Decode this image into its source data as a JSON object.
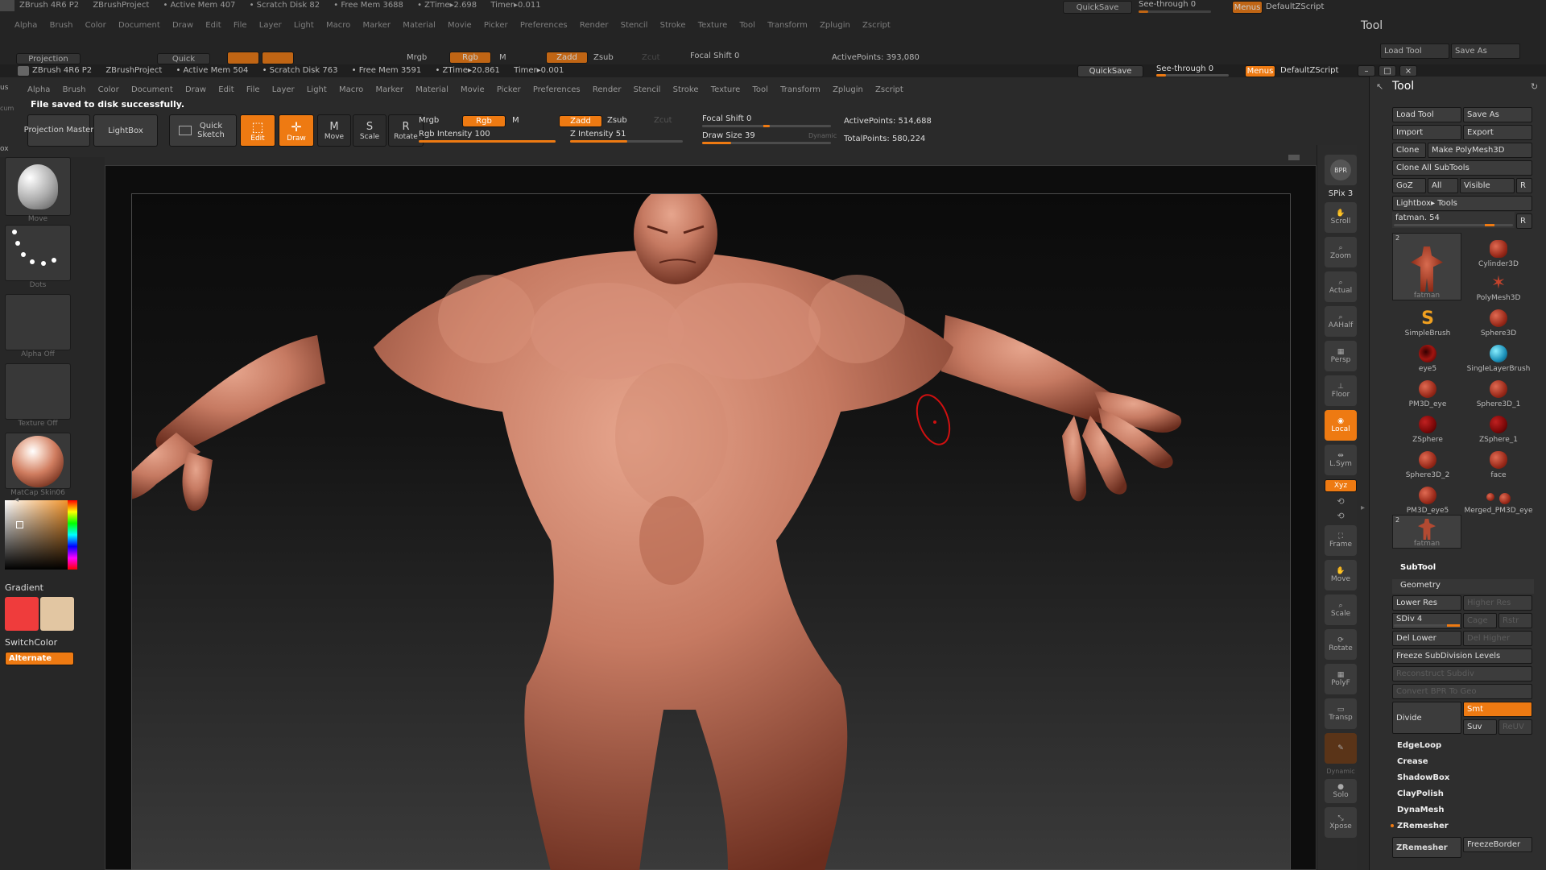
{
  "back_window": {
    "title": [
      "ZBrush 4R6 P2",
      "ZBrushProject",
      "• Active Mem 407",
      "• Scratch Disk 82",
      "• Free Mem 3688",
      "• ZTime▸2.698",
      "Timer▸0.011"
    ],
    "quicksave": "QuickSave",
    "seethrough": "See-through  0",
    "menus": "Menus",
    "default_zscript": "DefaultZScript",
    "menu_items": [
      "Alpha",
      "Brush",
      "Color",
      "Document",
      "Draw",
      "Edit",
      "File",
      "Layer",
      "Light",
      "Macro",
      "Marker",
      "Material",
      "Movie",
      "Picker",
      "Preferences",
      "Render",
      "Stencil",
      "Stroke",
      "Texture",
      "Tool",
      "Transform",
      "Zplugin",
      "Zscript"
    ],
    "toolbar": {
      "projection": "Projection",
      "quick": "Quick",
      "mrgb": "Mrgb",
      "rgb": "Rgb",
      "m": "M",
      "zadd": "Zadd",
      "zsub": "Zsub",
      "zcut": "Zcut",
      "focal_shift": "Focal Shift 0",
      "active_points": "ActivePoints: 393,080"
    },
    "tool_title": "Tool",
    "load_tool": "Load Tool",
    "save_as": "Save As"
  },
  "title_bar": {
    "items": [
      "ZBrush 4R6 P2",
      "ZBrushProject",
      "• Active Mem 504",
      "• Scratch Disk 763",
      "• Free Mem 3591",
      "• ZTime▸20.861",
      "Timer▸0.001"
    ],
    "quicksave": "QuickSave",
    "seethrough": "See-through  0",
    "menus": "Menus",
    "default_zscript": "DefaultZScript"
  },
  "menu_items": [
    "Alpha",
    "Brush",
    "Color",
    "Document",
    "Draw",
    "Edit",
    "File",
    "Layer",
    "Light",
    "Macro",
    "Marker",
    "Material",
    "Movie",
    "Picker",
    "Preferences",
    "Render",
    "Stencil",
    "Stroke",
    "Texture",
    "Tool",
    "Transform",
    "Zplugin",
    "Zscript"
  ],
  "status_message": "File saved to disk successfully.",
  "left_edge": {
    "a": "us",
    "b": "cum",
    "c": "ox"
  },
  "toolbar": {
    "projection_master": "Projection Master",
    "lightbox": "LightBox",
    "quick_sketch": "Quick Sketch",
    "edit": "Edit",
    "draw": "Draw",
    "move": "Move",
    "scale": "Scale",
    "rotate": "Rotate",
    "mrgb": "Mrgb",
    "rgb": "Rgb",
    "m": "M",
    "zadd": "Zadd",
    "zsub": "Zsub",
    "zcut": "Zcut",
    "rgb_intensity": "Rgb Intensity 100",
    "rgb_intensity_value": 1.0,
    "z_intensity": "Z Intensity 51",
    "z_intensity_value": 0.51,
    "focal_shift": "Focal Shift 0",
    "draw_size": "Draw Size 39",
    "dynamic": "Dynamic",
    "active_points": "ActivePoints: 514,688",
    "total_points": "TotalPoints: 580,224"
  },
  "left_shelf": {
    "brush_caption": "Move",
    "stroke_caption": "Dots",
    "alpha_caption": "Alpha  Off",
    "texture_caption": "Texture  Off",
    "material_caption": "MatCap  Skin06",
    "gradient": "Gradient",
    "switch_color": "SwitchColor",
    "alternate": "Alternate",
    "main_color": "#ef3c3c",
    "secondary_color": "#e2c6a2"
  },
  "right_shelf": {
    "bpr": "BPR",
    "spix": "SPix 3",
    "buttons": [
      "Scroll",
      "Zoom",
      "Actual",
      "AAHalf",
      "Persp",
      "Floor",
      "Local",
      "L.Sym",
      "Xyz",
      "Frame",
      "Move",
      "Scale",
      "Rotate",
      "PolyF",
      "Transp",
      "Dynamic",
      "Solo",
      "Xpose"
    ]
  },
  "tool_panel": {
    "title": "Tool",
    "load_tool": "Load Tool",
    "save_as": "Save As",
    "import": "Import",
    "export": "Export",
    "clone": "Clone",
    "make_polymesh": "Make PolyMesh3D",
    "clone_all": "Clone  All  SubTools",
    "goz": "GoZ",
    "all": "All",
    "visible": "Visible",
    "r": "R",
    "lightbox_tools": "Lightbox▸ Tools",
    "current_tool": "fatman. 54",
    "current_tool_slider": 0.83,
    "tools": [
      {
        "name": "fatman",
        "badge": "2"
      },
      {
        "name": "Cylinder3D"
      },
      {
        "name": "PolyMesh3D"
      },
      {
        "name": "SimpleBrush"
      },
      {
        "name": "Sphere3D"
      },
      {
        "name": "eye5"
      },
      {
        "name": "SingleLayerBrush"
      },
      {
        "name": "PM3D_eye"
      },
      {
        "name": "Sphere3D_1"
      },
      {
        "name": "ZSphere"
      },
      {
        "name": "ZSphere_1"
      },
      {
        "name": "Sphere3D_2"
      },
      {
        "name": "face"
      },
      {
        "name": "PM3D_eye5"
      },
      {
        "name": "Merged_PM3D_eye"
      },
      {
        "name": "fatman",
        "badge": "2"
      }
    ],
    "subtool": "SubTool",
    "geometry": "Geometry",
    "lower_res": "Lower Res",
    "higher_res": "Higher Res",
    "sdiv": "SDiv 4",
    "sdiv_value": 4,
    "cage": "Cage",
    "rstr": "Rstr",
    "del_lower": "Del Lower",
    "del_higher": "Del Higher",
    "freeze_subdiv": "Freeze SubDivision Levels",
    "reconstruct": "Reconstruct Subdiv",
    "convert_bpr": "Convert BPR To Geo",
    "divide": "Divide",
    "smt": "Smt",
    "suv": "Suv",
    "reuv": "ReUV",
    "sections": [
      "EdgeLoop",
      "Crease",
      "ShadowBox",
      "ClayPolish",
      "DynaMesh",
      "ZRemesher"
    ],
    "zremesher_btn": "ZRemesher",
    "freeze_border": "FreezeBorder"
  }
}
